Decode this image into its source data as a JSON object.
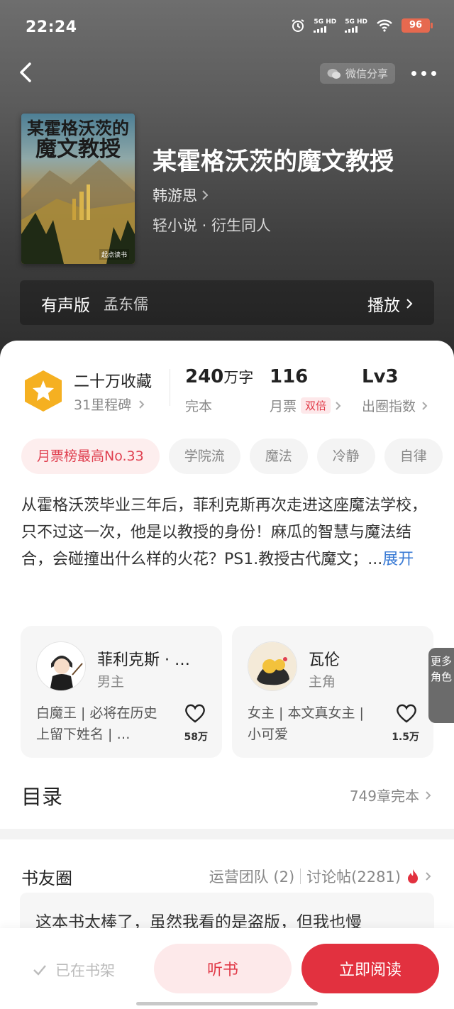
{
  "status": {
    "time": "22:24",
    "signal1": "5G HD",
    "signal2": "5G HD",
    "battery": "96"
  },
  "header": {
    "share_label": "微信分享"
  },
  "book": {
    "cover_title_line1": "某霍格沃茨的",
    "cover_title_line2": "魔文教授",
    "cover_logo": "起点读书",
    "title": "某霍格沃茨的魔文教授",
    "author": "韩游思",
    "genre": "轻小说 · 衍生同人"
  },
  "audio": {
    "label": "有声版",
    "narrator": "孟东儒",
    "play_label": "播放"
  },
  "stats": {
    "collect": "二十万收藏",
    "milestone": "31里程碑",
    "words_num": "240",
    "words_unit": "万字",
    "status": "完本",
    "votes": "116",
    "votes_label": "月票",
    "double_badge": "双倍",
    "level": "Lv3",
    "level_label": "出圈指数"
  },
  "tags": [
    "月票榜最高No.33",
    "学院流",
    "魔法",
    "冷静",
    "自律"
  ],
  "description": {
    "text": "从霍格沃茨毕业三年后，菲利克斯再次走进这座魔法学校，只不过这一次，他是以教授的身份！麻瓜的智慧与魔法结合，会碰撞出什么样的火花？PS1.教授古代魔文；...",
    "expand_label": "展开"
  },
  "roles": [
    {
      "name": "菲利克斯 · …",
      "type": "男主",
      "desc": "白魔王 | 必将在历史上留下姓名 | …",
      "likes": "58万"
    },
    {
      "name": "瓦伦",
      "type": "主角",
      "desc": "女主 | 本文真女主 | 小可爱",
      "likes": "1.5万"
    }
  ],
  "more_roles": "更多角色",
  "toc": {
    "title": "目录",
    "count": "749章完本"
  },
  "circle": {
    "title": "书友圈",
    "ops": "运营团队 (2)",
    "discuss": "讨论帖(2281)",
    "post_preview": "这本书太棒了，虽然我看的是盗版，但我也慢"
  },
  "bottom": {
    "shelf_label": "已在书架",
    "listen_label": "听书",
    "read_label": "立即阅读"
  },
  "colors": {
    "accent": "#e2313f",
    "accent_light": "#fde9ea",
    "badge_gold": "#f5b021",
    "link_blue": "#3a7bd5"
  }
}
